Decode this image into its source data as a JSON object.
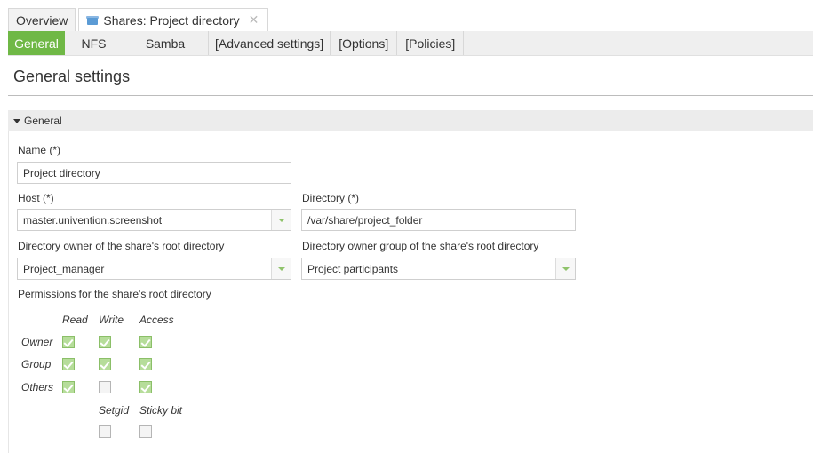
{
  "tabs": {
    "overview": "Overview",
    "share_tab": "Shares: Project directory",
    "close_glyph": "✕"
  },
  "subtabs": [
    "General",
    "NFS",
    "Samba",
    "[Advanced settings]",
    "[Options]",
    "[Policies]"
  ],
  "page_title": "General settings",
  "section": {
    "title": "General"
  },
  "fields": {
    "name": {
      "label": "Name (*)",
      "value": "Project directory"
    },
    "host": {
      "label": "Host (*)",
      "value": "master.univention.screenshot"
    },
    "directory": {
      "label": "Directory (*)",
      "value": "/var/share/project_folder"
    },
    "owner": {
      "label": "Directory owner of the share's root directory",
      "value": "Project_manager"
    },
    "owner_group": {
      "label": "Directory owner group of the share's root directory",
      "value": "Project participants"
    }
  },
  "permissions": {
    "label": "Permissions for the share's root directory",
    "columns": [
      "Read",
      "Write",
      "Access"
    ],
    "rows": [
      {
        "name": "Owner",
        "values": [
          true,
          true,
          true
        ]
      },
      {
        "name": "Group",
        "values": [
          true,
          true,
          true
        ]
      },
      {
        "name": "Others",
        "values": [
          true,
          false,
          true
        ]
      }
    ],
    "special_columns": [
      "Setgid",
      "Sticky bit"
    ],
    "special_values": [
      false,
      false
    ]
  },
  "colors": {
    "accent": "#6fb846",
    "checkbox_checked": "#b6dd9a"
  },
  "icons": {
    "share_tab": "share-folder-icon",
    "close": "close-icon",
    "dropdown": "chevron-down-icon",
    "section": "triangle-down-icon"
  }
}
